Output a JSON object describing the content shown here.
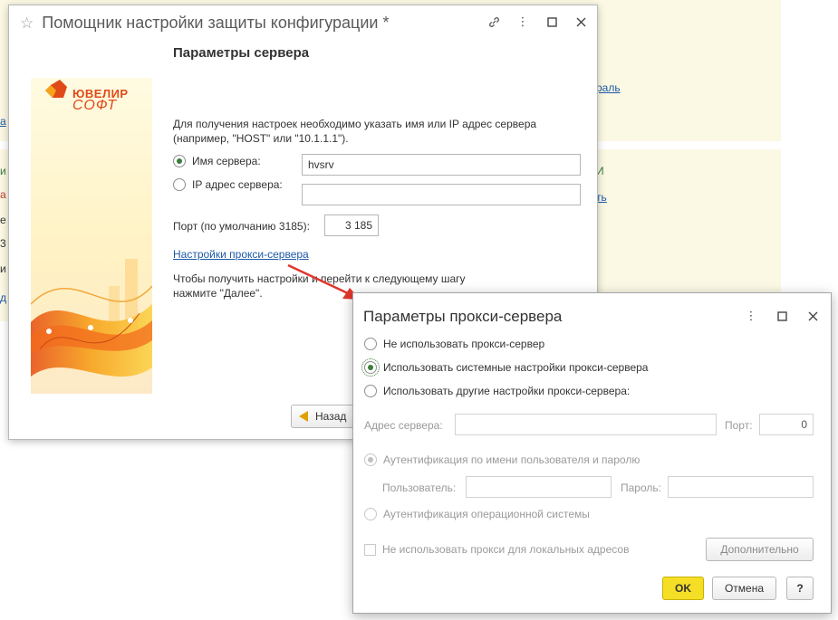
{
  "background": {
    "links": [
      "раль",
      "ть",
      "а",
      "д"
    ],
    "fragments": [
      "и",
      "а",
      "е",
      "3",
      "и",
      "И"
    ]
  },
  "wizard": {
    "title": "Помощник настройки защиты конфигурации *",
    "logo": {
      "line1": "ЮВЕЛИР",
      "line2": "СОФТ"
    },
    "heading": "Параметры сервера",
    "description": "Для получения настроек необходимо указать имя или IP адрес сервера (например, \"HOST\" или \"10.1.1.1\").",
    "server_name_label": "Имя сервера:",
    "server_name_value": "hvsrv",
    "ip_label": "IP адрес сервера:",
    "ip_value": "",
    "port_label": "Порт (по умолчанию 3185):",
    "port_value": "3 185",
    "proxy_link": "Настройки прокси-сервера",
    "hint": "Чтобы получить настройки и перейти к следующему шагу нажмите \"Далее\".",
    "back_label": "Назад"
  },
  "proxy": {
    "title": "Параметры прокси-сервера",
    "opt_none": "Не использовать прокси-сервер",
    "opt_system": "Использовать системные настройки прокси-сервера",
    "opt_other": "Использовать другие настройки прокси-сервера:",
    "address_label": "Адрес сервера:",
    "address_value": "",
    "port_label": "Порт:",
    "port_value": "0",
    "auth_user": "Аутентификация по имени пользователя и паролю",
    "user_label": "Пользователь:",
    "password_label": "Пароль:",
    "auth_os": "Аутентификация операционной системы",
    "no_local": "Не использовать прокси для локальных адресов",
    "more_button": "Дополнительно",
    "ok_button": "OK",
    "cancel_button": "Отмена",
    "help_button": "?"
  },
  "colors": {
    "accent_yellow": "#f5df26",
    "link_blue": "#1e5aa8",
    "arrow_red": "#e0372c",
    "radio_green": "#3a7d3a"
  }
}
